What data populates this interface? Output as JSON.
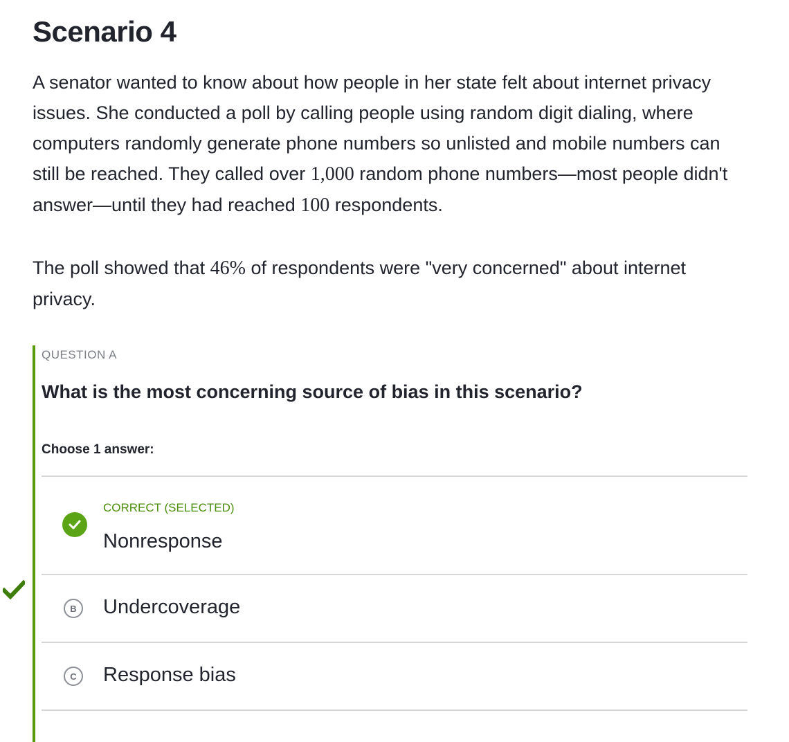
{
  "scenario": {
    "title": "Scenario 4",
    "paragraph1": {
      "text_1": "A senator wanted to know about how people in her state felt about internet privacy issues. She conducted a poll by calling people using random digit dialing, where computers randomly generate phone numbers so unlisted and mobile numbers can still be reached. They called over ",
      "num_calls": "1,000",
      "text_2": " random phone numbers—most people didn't answer—until they had reached ",
      "num_respondents": "100",
      "text_3": " respondents."
    },
    "paragraph2": {
      "text_1": "The poll showed that ",
      "percent": "46%",
      "text_2": " of respondents were \"very concerned\" about internet privacy."
    }
  },
  "question": {
    "label": "QUESTION A",
    "text": "What is the most concerning source of bias in this scenario?",
    "instruction": "Choose 1 answer:",
    "accent_color": "#5b9b0a",
    "choices": [
      {
        "letter": "A",
        "status": "CORRECT (SELECTED)",
        "text": "Nonresponse",
        "selected": true,
        "correct": true
      },
      {
        "letter": "B",
        "text": "Undercoverage",
        "selected": false
      },
      {
        "letter": "C",
        "text": "Response bias",
        "selected": false
      }
    ]
  },
  "icons": {
    "selected_check": "check-circle-icon",
    "side_mark": "checkmark-icon",
    "success_color": "#5ba415",
    "side_check_color": "#3f7d0a"
  }
}
